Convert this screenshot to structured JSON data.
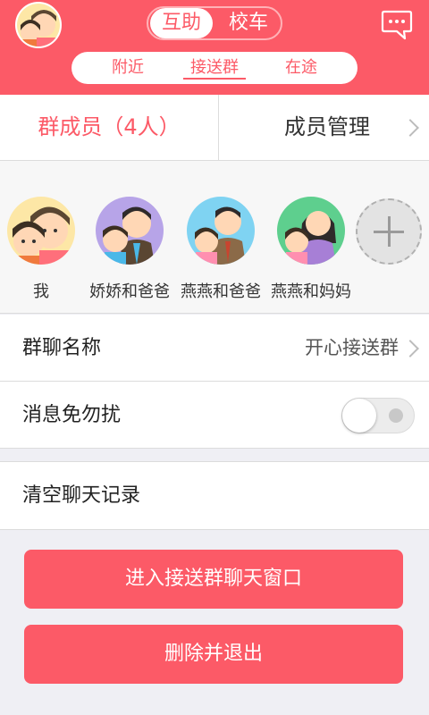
{
  "header": {
    "segments": [
      {
        "label": "互助",
        "active": true
      },
      {
        "label": "校车",
        "active": false
      }
    ],
    "subtabs": [
      {
        "label": "附近",
        "active": false
      },
      {
        "label": "接送群",
        "active": true
      },
      {
        "label": "在途",
        "active": false
      }
    ],
    "chat_icon": "chat-bubble-icon",
    "avatar_icon": "user-avatar"
  },
  "members_bar": {
    "count_label": "群成员（4人）",
    "manage_label": "成员管理"
  },
  "members": [
    {
      "name": "我"
    },
    {
      "name": "娇娇和爸爸"
    },
    {
      "name": "燕燕和爸爸"
    },
    {
      "name": "燕燕和妈妈"
    }
  ],
  "settings": {
    "group_name_label": "群聊名称",
    "group_name_value": "开心接送群",
    "mute_label": "消息免勿扰",
    "mute_on": false,
    "clear_label": "清空聊天记录"
  },
  "actions": {
    "enter_chat": "进入接送群聊天窗口",
    "delete_exit": "删除并退出"
  },
  "colors": {
    "accent": "#fc5a67",
    "background": "#efeff4"
  }
}
